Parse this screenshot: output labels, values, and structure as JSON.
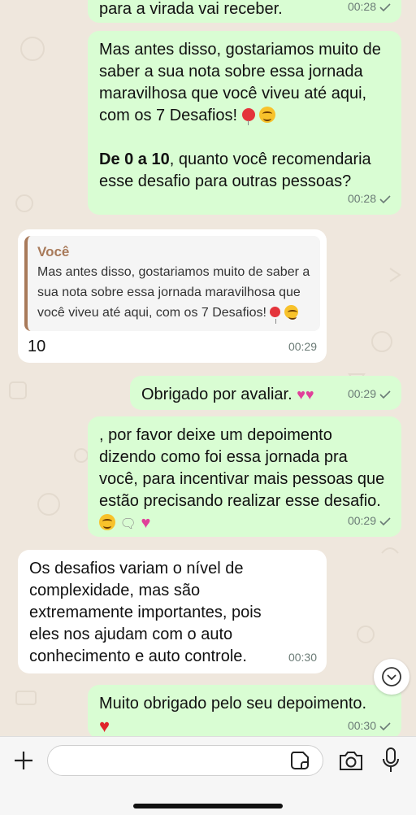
{
  "messages": [
    {
      "type": "out",
      "text": "para a virada vai receber.",
      "time": "00:28"
    },
    {
      "type": "out",
      "text": "Mas antes disso, gostariamos muito de saber a sua nota sobre essa jornada maravilhosa que você viveu até aqui, com os 7 Desafios!",
      "bold_prefix": "De 0 a 10",
      "text2": ", quanto você recomendaria esse desafio para outras pessoas?",
      "time": "00:28"
    },
    {
      "type": "in",
      "quote_author": "Você",
      "quote_text": "Mas antes disso, gostariamos muito de saber a sua nota sobre essa jornada maravilhosa que você viveu até aqui, com os 7 Desafios!",
      "text": "10",
      "time": "00:29"
    },
    {
      "type": "out",
      "text": "Obrigado por avaliar.",
      "time": "00:29"
    },
    {
      "type": "out",
      "text": "​, por favor deixe um depoimento dizendo como foi essa jornada pra você, para incentivar mais pessoas que estão precisando realizar esse desafio.",
      "time": "00:29"
    },
    {
      "type": "in",
      "text": "Os desafios variam o nível de complexidade, mas são extremamente importantes, pois eles nos ajudam com o auto conhecimento e auto controle.",
      "time": "00:30"
    },
    {
      "type": "out",
      "text": "Muito obrigado pelo seu depoimento.",
      "time": "00:30"
    }
  ],
  "input": {
    "placeholder": "",
    "value": ""
  },
  "colors": {
    "outgoing": "#d9fdd3",
    "incoming": "#ffffff",
    "background": "#efe7dd",
    "quote_accent": "#a87a5a",
    "tick": "#6b7b76"
  },
  "icons": [
    "check-icon",
    "heart-emoji",
    "balloon-emoji",
    "smile-emoji",
    "plus-icon",
    "sticker-icon",
    "camera-icon",
    "mic-icon",
    "chevron-down-icon"
  ]
}
